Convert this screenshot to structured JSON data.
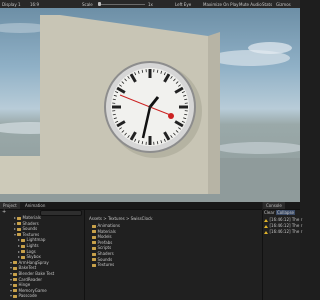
{
  "game_toolbar": {
    "display": "Display 1",
    "aspect": "16:9",
    "scale_label": "Scale",
    "scale_value": "1x",
    "play_focused": "Left Eye",
    "maximize": "Maximize On Play",
    "mute": "Mute Audio",
    "stats": "Stats",
    "gizmos": "Gizmos"
  },
  "bottom": {
    "tabs": [
      "Project",
      "Animation"
    ],
    "add_button": "+",
    "hierarchy_rows": [
      {
        "label": "Materials",
        "level": 1,
        "expanded": false
      },
      {
        "label": "Shaders",
        "level": 1,
        "expanded": false
      },
      {
        "label": "Sounds",
        "level": 1,
        "expanded": false
      },
      {
        "label": "Textures",
        "level": 1,
        "expanded": true
      },
      {
        "label": "Lightmap",
        "level": 2,
        "expanded": false
      },
      {
        "label": "Lights",
        "level": 2,
        "expanded": false
      },
      {
        "label": "Logs",
        "level": 2,
        "expanded": false
      },
      {
        "label": "Skybox",
        "level": 2,
        "expanded": false
      },
      {
        "label": "ArmHangSpray",
        "level": 0,
        "expanded": true
      },
      {
        "label": "BakeTest",
        "level": 0,
        "expanded": true
      },
      {
        "label": "Blender Bake Test",
        "level": 0,
        "expanded": true
      },
      {
        "label": "CardReader",
        "level": 0,
        "expanded": true
      },
      {
        "label": "Hinge",
        "level": 0,
        "expanded": true
      },
      {
        "label": "MemoryGame",
        "level": 0,
        "expanded": true
      },
      {
        "label": "Passcode",
        "level": 0,
        "expanded": true
      }
    ],
    "breadcrumb": [
      "Assets",
      "Textures",
      "SwissClock"
    ],
    "asset_folders": [
      "Animations",
      "Materials",
      "Models",
      "Prefabs",
      "Scripts",
      "Shaders",
      "Sounds",
      "Textures"
    ],
    "console_tab": "Console",
    "console_toolbar": [
      "Clear",
      "Collapse"
    ],
    "console_rows": [
      "[16:46:12] The r",
      "[16:46:12] The r",
      "[16:46:12] The r"
    ]
  }
}
